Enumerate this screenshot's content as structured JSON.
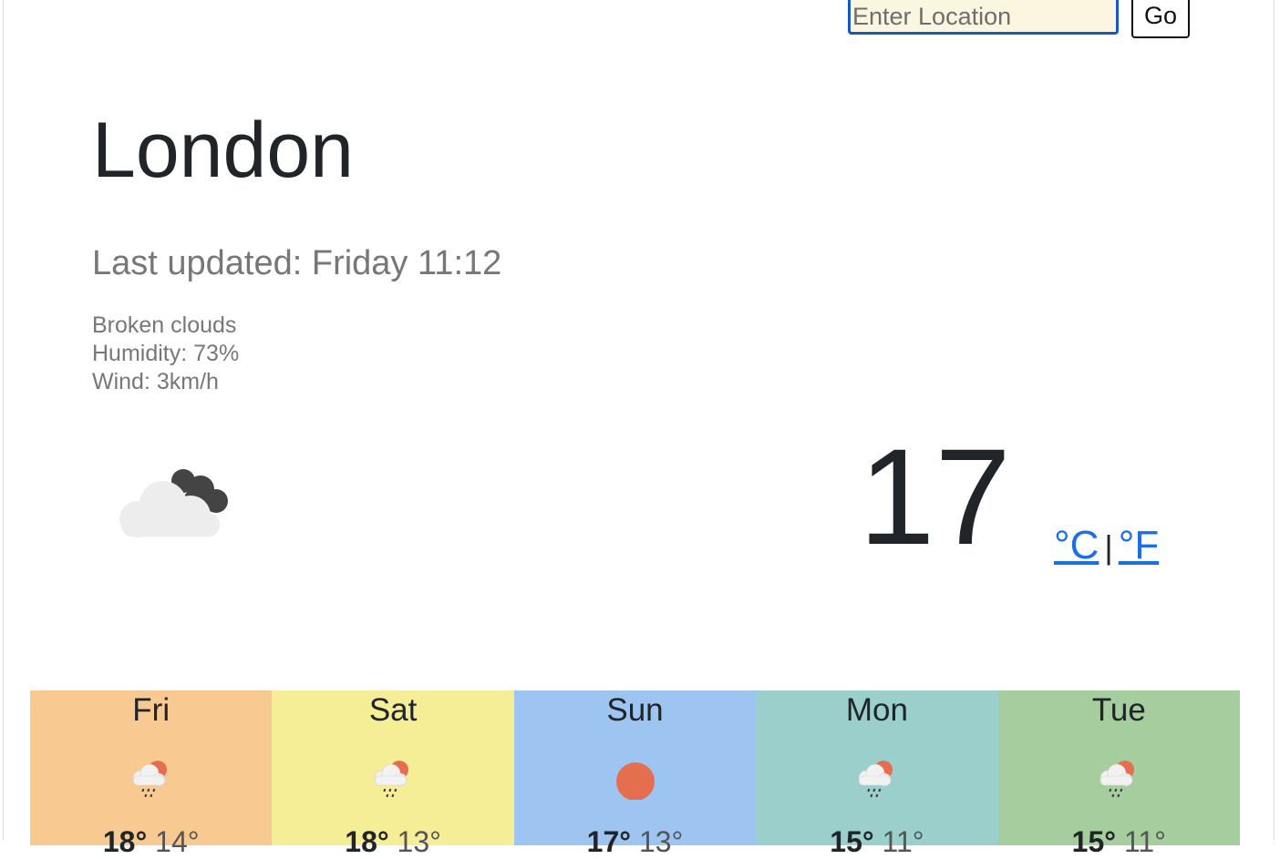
{
  "search": {
    "placeholder": "Enter Location",
    "go_label": "Go"
  },
  "city": "London",
  "last_updated": "Last updated: Friday 11:12",
  "details": {
    "description": "Broken clouds",
    "humidity": "Humidity: 73%",
    "wind": "Wind: 3km/h"
  },
  "current": {
    "temperature": "17",
    "icon": "broken-clouds-icon",
    "unit_c": "°C",
    "unit_sep": "|",
    "unit_f": "°F"
  },
  "forecast": [
    {
      "day": "Fri",
      "icon": "rain-sun-icon",
      "high": "18°",
      "low": "14°",
      "color": "#f8c991"
    },
    {
      "day": "Sat",
      "icon": "rain-sun-icon",
      "high": "18°",
      "low": "13°",
      "color": "#f5ee96"
    },
    {
      "day": "Sun",
      "icon": "sun-icon",
      "high": "17°",
      "low": "13°",
      "color": "#9ec5f1"
    },
    {
      "day": "Mon",
      "icon": "rain-sun-icon",
      "high": "15°",
      "low": "11°",
      "color": "#9acfcb"
    },
    {
      "day": "Tue",
      "icon": "rain-sun-icon",
      "high": "15°",
      "low": "11°",
      "color": "#a6cd9e"
    }
  ],
  "colors": {
    "accent": "#1a6ee8",
    "input_border": "#1a56c8",
    "input_bg": "#faf6e0",
    "sun": "#e56e4e"
  }
}
